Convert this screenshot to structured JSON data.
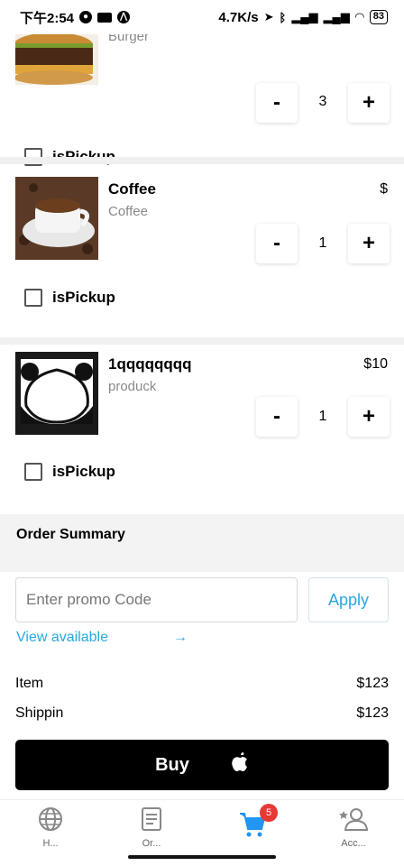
{
  "status_bar": {
    "time": "下午2:54",
    "net_speed": "4.7K/s",
    "battery": "83"
  },
  "cart": {
    "items": [
      {
        "name": "",
        "subtitle": "Burger",
        "price": "",
        "qty": "3",
        "pickup_label": "isPickup",
        "thumb_icon": "burger-image"
      },
      {
        "name": "Coffee",
        "subtitle": "Coffee",
        "price": "$",
        "qty": "1",
        "pickup_label": "isPickup",
        "thumb_icon": "coffee-image"
      },
      {
        "name": "1qqqqqqqq",
        "subtitle": "produck",
        "price": "$10",
        "qty": "1",
        "pickup_label": "isPickup",
        "thumb_icon": "panda-image"
      }
    ],
    "minus_label": "-",
    "plus_label": "+"
  },
  "summary": {
    "title": "Order Summary",
    "promo_placeholder": "Enter promo Code",
    "apply_label": "Apply",
    "view_available": "View available",
    "view_arrow": "→",
    "rows": [
      {
        "label": "Item",
        "value": "$123"
      },
      {
        "label": "Shippin",
        "value": "$123"
      }
    ]
  },
  "buy": {
    "label": "Buy",
    "icon": ""
  },
  "nav": {
    "items": [
      {
        "label": "H...",
        "icon": "globe-icon"
      },
      {
        "label": "Or...",
        "icon": "orders-icon"
      },
      {
        "label": "",
        "icon": "cart-icon",
        "badge": "5"
      },
      {
        "label": "Acc...",
        "icon": "account-icon"
      }
    ]
  },
  "colors": {
    "accent": "#29a8e0",
    "cart_active": "#2196f3",
    "badge": "#e53935"
  }
}
